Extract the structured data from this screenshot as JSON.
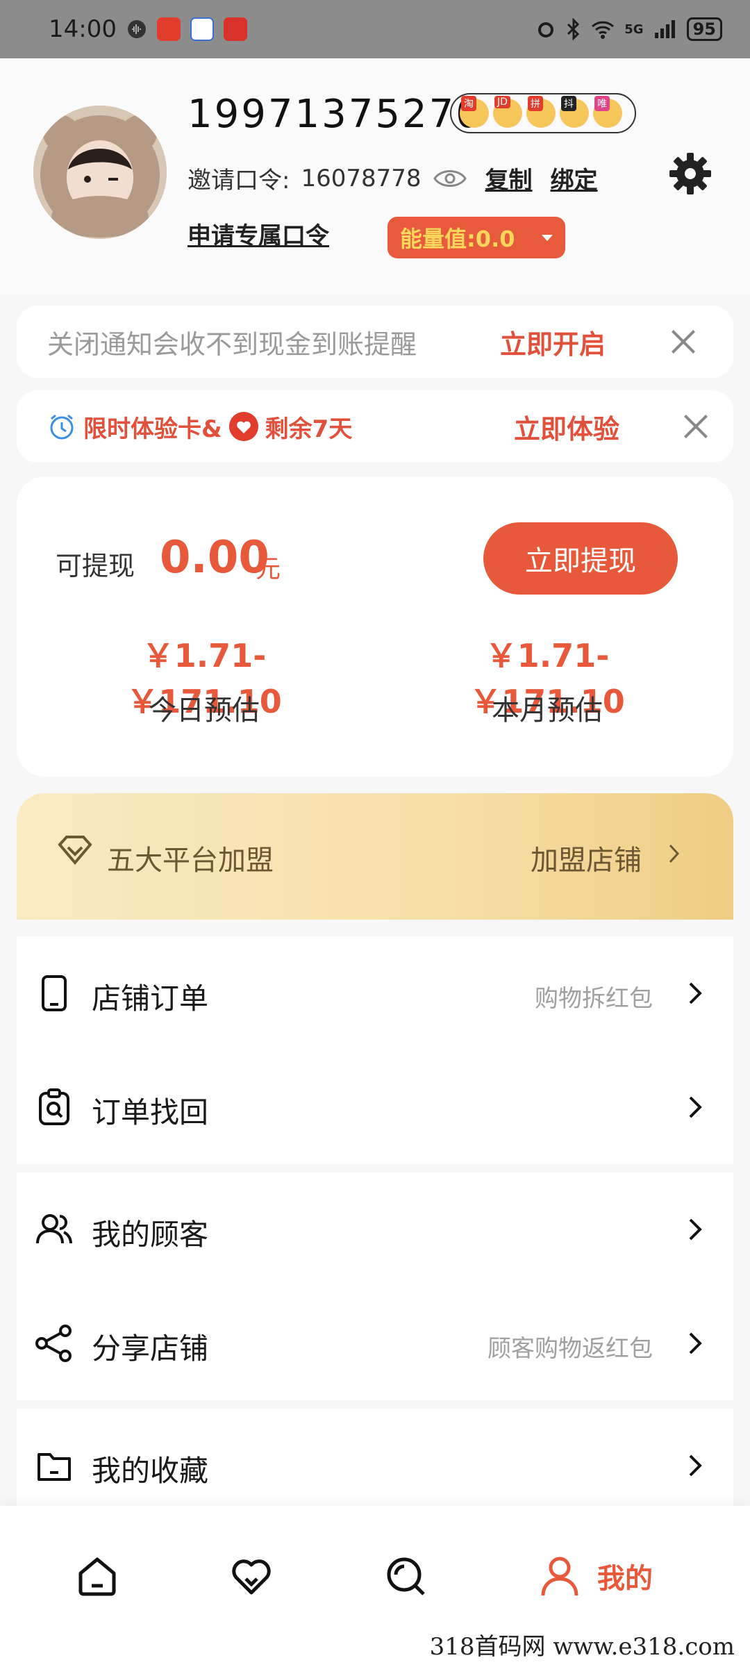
{
  "status_bar": {
    "time": "14:00",
    "network": "5G",
    "battery": "95"
  },
  "profile": {
    "phone": "19971375270",
    "platforms": [
      "淘",
      "JD",
      "拼",
      "抖",
      "唯"
    ],
    "invite_label": "邀请口令:",
    "invite_code": "16078778",
    "copy_label": "复制",
    "bind_label": "绑定",
    "apply_label": "申请专属口令",
    "energy_label": "能量值:0.0"
  },
  "notice": {
    "text": "关闭通知会收不到现金到账提醒",
    "cta": "立即开启"
  },
  "promo": {
    "title": "限时体验卡&",
    "remaining": "剩余7天",
    "cta": "立即体验"
  },
  "balance": {
    "withdraw_label": "可提现",
    "withdraw_value": "0.00",
    "unit": "元",
    "withdraw_button": "立即提现",
    "today_value": "￥1.71-￥171.10",
    "today_label": "今日预估",
    "month_value": "￥1.71-￥171.10",
    "month_label": "本月预估"
  },
  "franchise": {
    "title": "五大平台加盟",
    "cta": "加盟店铺"
  },
  "menu": {
    "orders": {
      "label": "店铺订单",
      "hint": "购物拆红包"
    },
    "retrieve": {
      "label": "订单找回"
    },
    "customers": {
      "label": "我的顾客"
    },
    "share": {
      "label": "分享店铺",
      "hint": "顾客购物返红包"
    },
    "favorites": {
      "label": "我的收藏"
    }
  },
  "nav": {
    "mine_label": "我的"
  },
  "watermark": "318首码网 www.e318.com",
  "colors": {
    "accent": "#e8593c",
    "energy_text": "#ffd75a",
    "franchise_text": "#6b5732"
  }
}
